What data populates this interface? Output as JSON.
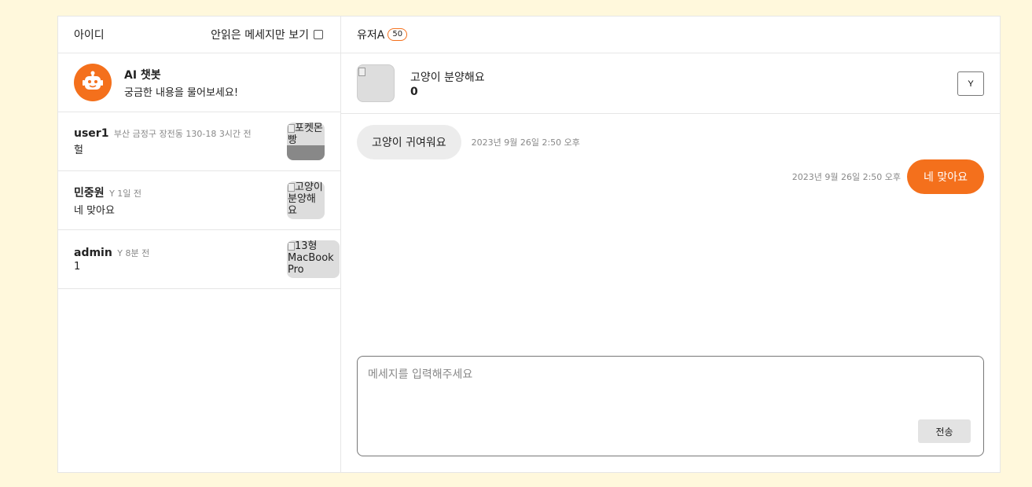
{
  "sidebar": {
    "title": "아이디",
    "filter_label": "안읽은 메세지만 보기",
    "bot": {
      "name": "AI 챗봇",
      "desc": "궁금한 내용을 물어보세요!"
    },
    "chats": [
      {
        "name": "user1",
        "meta": "부산 금정구 장전동 130-18 3시간 전",
        "message": "헐",
        "thumb_alt": "포켓몬빵"
      },
      {
        "name": "민중원",
        "meta": "Y 1일 전",
        "message": "네 맞아요",
        "thumb_alt": "고양이 분양해요"
      },
      {
        "name": "admin",
        "meta": "Y 8분 전",
        "message": "1",
        "thumb_alt": "13형 MacBook Pro"
      }
    ]
  },
  "chat": {
    "partner": "유저A",
    "partner_badge": "50",
    "product": {
      "title": "고양이 분양해요",
      "price": "0",
      "status_button": "Y"
    },
    "messages": [
      {
        "direction": "in",
        "text": "고양이 귀여워요",
        "time": "2023년 9월 26일 2:50 오후"
      },
      {
        "direction": "out",
        "text": "네 맞아요",
        "time": "2023년 9월 26일 2:50 오후"
      }
    ],
    "input": {
      "placeholder": "메세지를 입력해주세요",
      "value": ""
    },
    "send_label": "전송"
  },
  "colors": {
    "accent": "#f4701c",
    "background": "#fff8dc",
    "incoming_bubble": "#ececec"
  },
  "icons": {
    "bot": "robot-icon",
    "checkbox": "checkbox-icon",
    "broken_image": "broken-image-icon"
  }
}
